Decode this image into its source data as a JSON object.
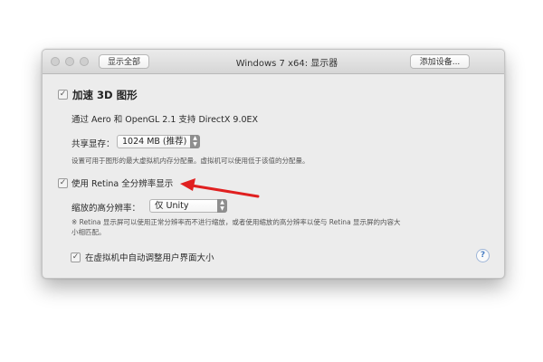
{
  "window": {
    "title": "Windows 7 x64: 显示器",
    "show_all_label": "显示全部",
    "add_device_label": "添加设备..."
  },
  "accel3d": {
    "label_prefix": "加速 ",
    "label_bold": "3D",
    "label_suffix": " 图形",
    "checked": true,
    "description": "通过 Aero 和 OpenGL 2.1 支持 DirectX 9.0EX"
  },
  "shared_memory": {
    "label": "共享显存：",
    "value": "1024 MB (推荐)",
    "note": "设置可用于图形的最大虚拟机内存分配量。虚拟机可以使用低于该值的分配量。"
  },
  "retina": {
    "label": "使用 Retina 全分辨率显示",
    "checked": true
  },
  "scaled_resolution": {
    "label": "缩放的高分辨率：",
    "value": "仅 Unity",
    "note_line1": "※ Retina 显示屏可以使用正常分辨率而不进行缩放，或者使用缩放的高分辨率以使与 Retina 显示屏的内容大",
    "note_line2": "小相匹配。"
  },
  "auto_resize": {
    "label": "在虚拟机中自动调整用户界面大小",
    "checked": true
  },
  "icons": {
    "checkbox_checked": "✓",
    "help": "?",
    "stepper_up": "▲",
    "stepper_down": "▼"
  },
  "colors": {
    "annotation_arrow": "#e02020"
  }
}
